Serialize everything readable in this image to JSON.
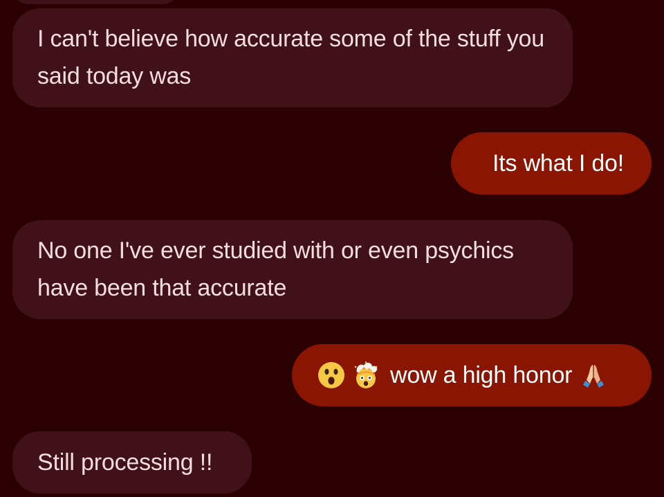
{
  "conversation": {
    "messages": [
      {
        "direction": "incoming",
        "text": ""
      },
      {
        "direction": "incoming",
        "text": "I can't believe how accurate some of the stuff you said today was"
      },
      {
        "direction": "outgoing",
        "text": "Its what I do!"
      },
      {
        "direction": "incoming",
        "text": "No one I've ever studied with or even psychics have been that accurate"
      },
      {
        "direction": "outgoing",
        "text": "wow a high honor",
        "emoji_before": [
          "astonished-face-emoji",
          "exploding-head-emoji"
        ],
        "emoji_after": [
          "folded-hands-emoji"
        ]
      },
      {
        "direction": "incoming",
        "text": "Still processing !!"
      }
    ]
  },
  "colors": {
    "background": "#2a0003",
    "incoming_bubble": "#41111a",
    "outgoing_bubble": "#8b1503",
    "incoming_text": "#f4dedd",
    "outgoing_text": "#ffffff"
  }
}
